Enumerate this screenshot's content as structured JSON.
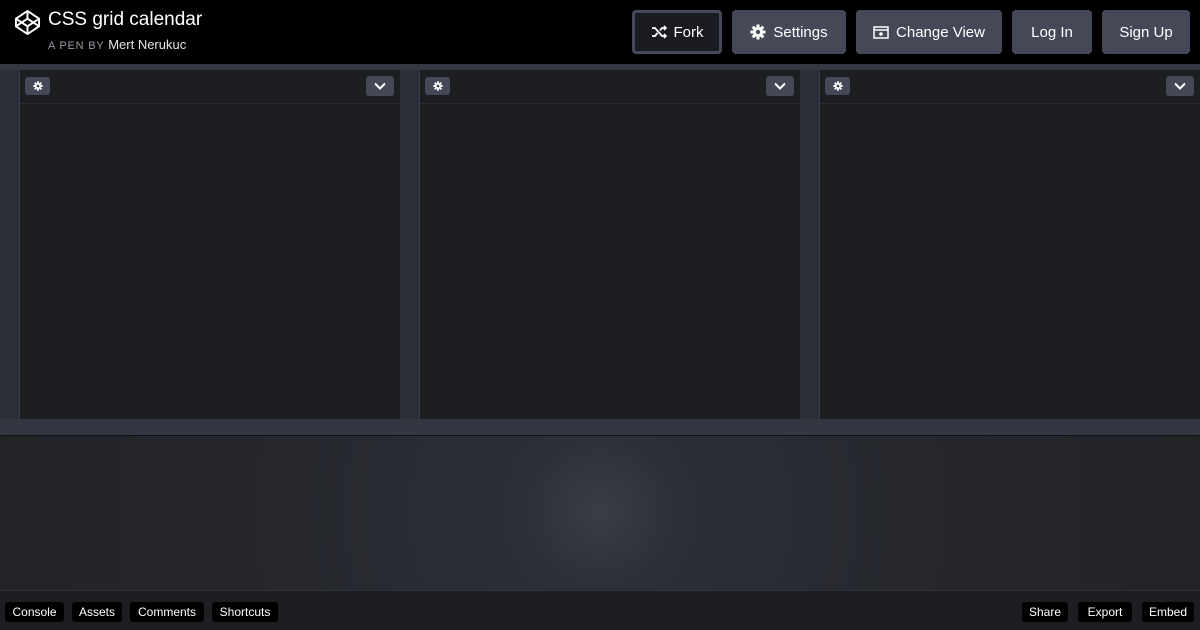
{
  "header": {
    "title": "CSS grid calendar",
    "byline_prefix": "A PEN BY",
    "author": "Mert Nerukuc",
    "buttons": {
      "fork": "Fork",
      "settings": "Settings",
      "change_view": "Change View",
      "login": "Log In",
      "signup": "Sign Up"
    }
  },
  "footer": {
    "left": [
      "Console",
      "Assets",
      "Comments",
      "Shortcuts"
    ],
    "right": [
      "Share",
      "Export",
      "Embed"
    ]
  },
  "icons": {
    "logo": "codepen-logo-icon",
    "fork": "fork-icon",
    "settings": "gear-icon",
    "change_view": "window-icon",
    "editor_settings": "gear-icon",
    "editor_collapse": "chevron-down-icon"
  },
  "colors": {
    "header_bg": "#000000",
    "button_bg": "#444857",
    "editor_bg": "#1d1e22"
  }
}
